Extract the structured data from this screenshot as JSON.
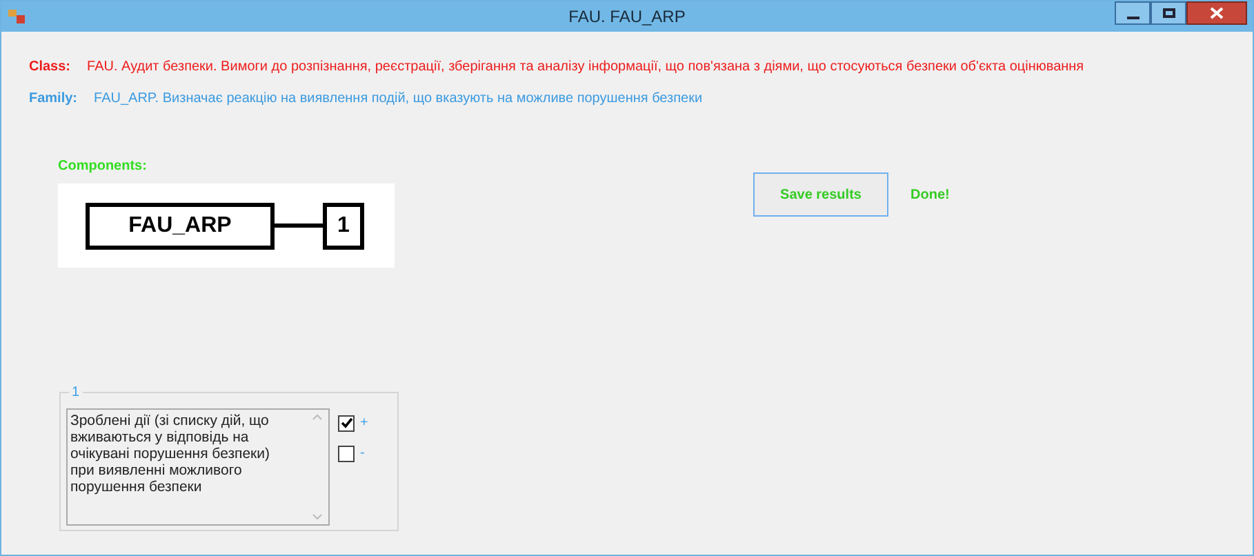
{
  "window": {
    "title": "FAU. FAU_ARP"
  },
  "class": {
    "label": "Class:",
    "text": "FAU. Аудит безпеки. Вимоги до розпізнання, реєстрації, зберігання та аналізу інформації, що пов'язана з діями, що стосуються безпеки об'єкта оцінювання"
  },
  "family": {
    "label": "Family:",
    "text": "FAU_ARP. Визначає реакцію на виявлення подій, що вказують на можливе порушення безпеки"
  },
  "components": {
    "label": "Components:",
    "name": "FAU_ARP",
    "count": "1"
  },
  "save_button": "Save results",
  "status": "Done!",
  "group": {
    "title": "1",
    "text": "Зроблені дії (зі списку дій, що вживаються у відповідь на очікувані порушення безпеки) при виявленні можливого порушення безпеки",
    "options": [
      {
        "label": "+",
        "checked": true
      },
      {
        "label": "-",
        "checked": false
      }
    ]
  }
}
